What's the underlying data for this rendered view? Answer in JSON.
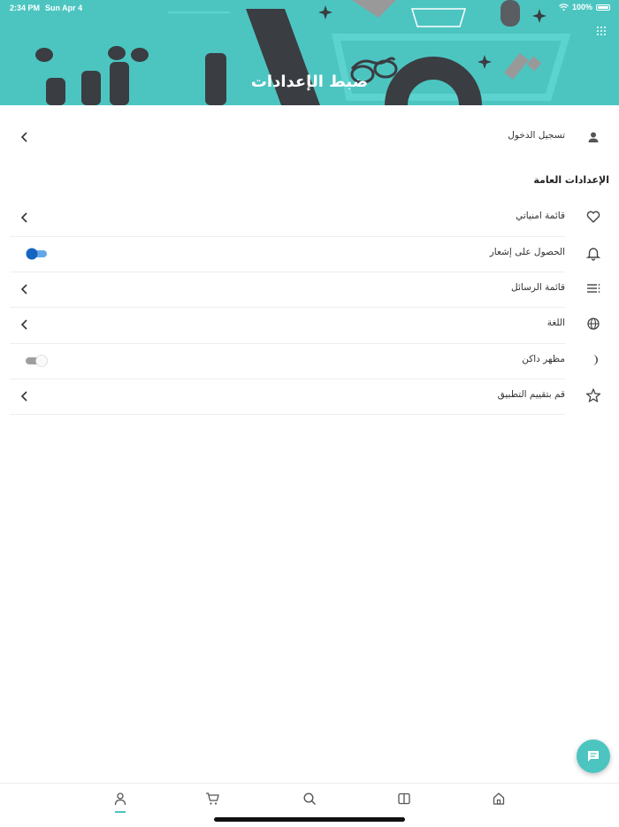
{
  "status_bar": {
    "time": "2:34 PM",
    "date": "Sun Apr 4",
    "battery": "100%"
  },
  "header": {
    "title": "ضبط الإعدادات"
  },
  "login": {
    "label": "تسجيل الدخول",
    "icon": "person-icon"
  },
  "section": {
    "title": "الإعدادات العامة"
  },
  "settings": [
    {
      "label": "قائمة امنياتي",
      "icon": "heart-icon",
      "control": "chevron"
    },
    {
      "label": "الحصول على إشعار",
      "icon": "bell-icon",
      "control": "toggle",
      "value": "on"
    },
    {
      "label": "قائمة الرسائل",
      "icon": "list-icon",
      "control": "chevron"
    },
    {
      "label": "اللغة",
      "icon": "globe-icon",
      "control": "chevron"
    },
    {
      "label": "مظهر داكن",
      "icon": "moon-icon",
      "control": "toggle",
      "value": "off"
    },
    {
      "label": "قم بتقييم التطبيق",
      "icon": "star-icon",
      "control": "chevron"
    }
  ],
  "bottom_tabs": [
    {
      "name": "profile",
      "icon": "person-icon",
      "active": true
    },
    {
      "name": "cart",
      "icon": "cart-icon"
    },
    {
      "name": "search",
      "icon": "search-icon"
    },
    {
      "name": "catalog",
      "icon": "book-icon"
    },
    {
      "name": "home",
      "icon": "home-icon"
    }
  ],
  "colors": {
    "accent": "#4cc5c1",
    "toggle_on": "#1565c0",
    "toggle_off": "#9e9e9e"
  }
}
